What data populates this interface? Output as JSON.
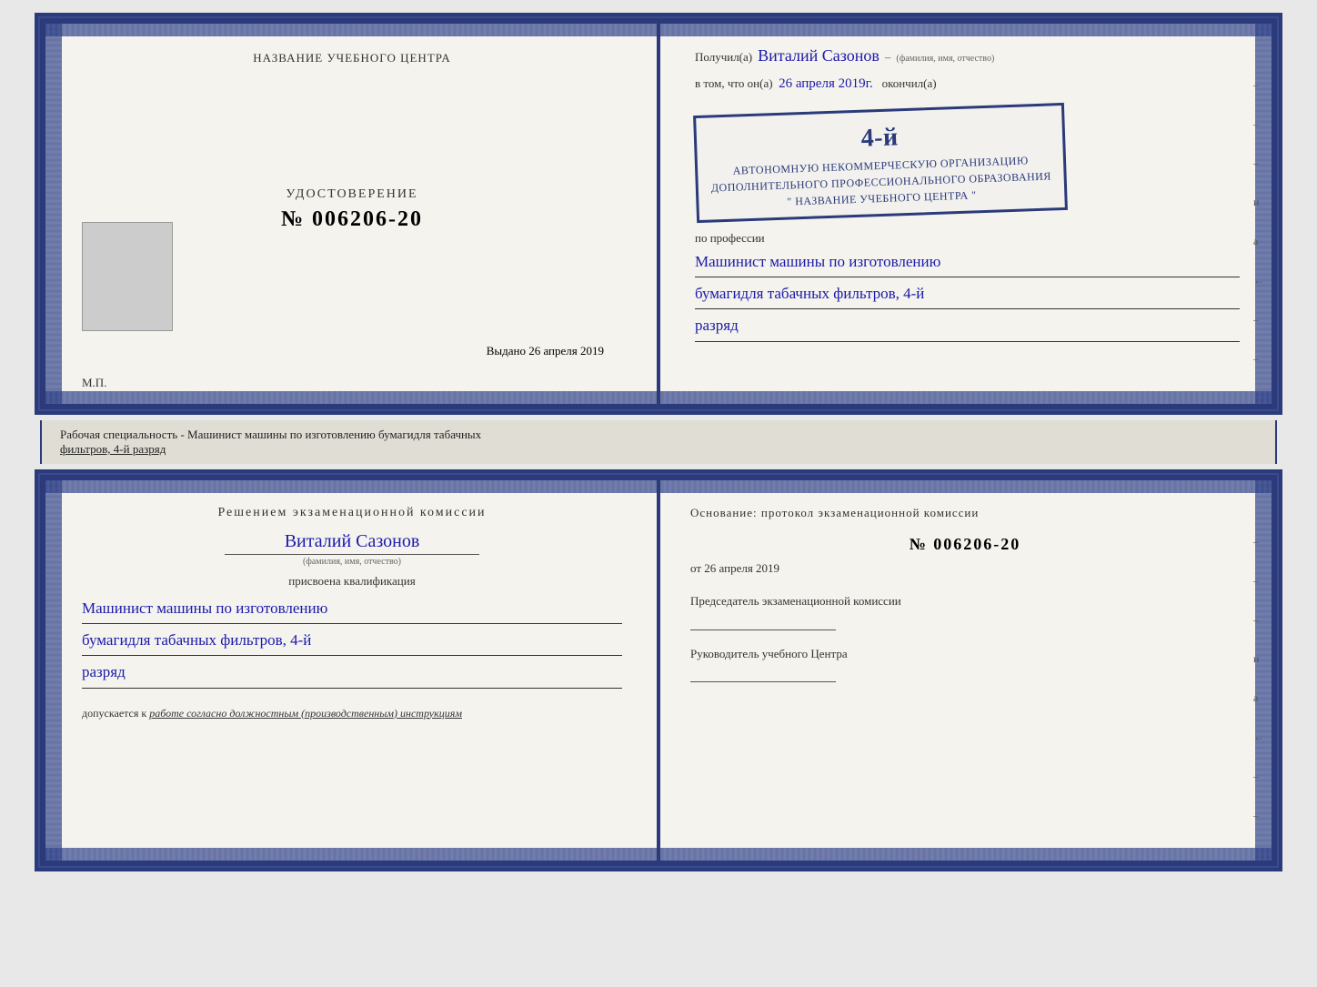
{
  "top": {
    "left": {
      "heading": "НАЗВАНИЕ УЧЕБНОГО ЦЕНТРА",
      "cert_label": "УДОСТОВЕРЕНИЕ",
      "cert_number": "№ 006206-20",
      "issued_label": "Выдано",
      "issued_date": "26 апреля 2019",
      "mp_label": "М.П."
    },
    "right": {
      "received_label": "Получил(а)",
      "recipient_name": "Виталий Сазонов",
      "recipient_subtext": "(фамилия, имя, отчество)",
      "in_fact_label": "в том, что он(а)",
      "date_filled": "26 апреля 2019г.",
      "completed_label": "окончил(а)",
      "stamp_line1": "4-й",
      "stamp_line2": "АВТОНОМНУЮ НЕКОММЕРЧЕСКУЮ ОРГАНИЗАЦИЮ",
      "stamp_line3": "ДОПОЛНИТЕЛЬНОГО ПРОФЕССИОНАЛЬНОГО ОБРАЗОВАНИЯ",
      "stamp_line4": "\" НАЗВАНИЕ УЧЕБНОГО ЦЕНТРА \"",
      "profession_label": "по профессии",
      "profession_line1": "Машинист машины по изготовлению",
      "profession_line2": "бумагидля табачных фильтров, 4-й",
      "profession_line3": "разряд",
      "edge_marks": [
        "–",
        "–",
        "–",
        "и",
        "а",
        "←",
        "–",
        "–",
        "–",
        "–"
      ]
    }
  },
  "divider": {
    "text_normal": "Рабочая специальность - Машинист машины по изготовлению бумагидля табачных",
    "text_underline": "фильтров, 4-й разряд"
  },
  "bottom": {
    "left": {
      "commission_title": "Решением  экзаменационной  комиссии",
      "person_name": "Виталий Сазонов",
      "person_subtext": "(фамилия, имя, отчество)",
      "qualifier_text": "присвоена квалификация",
      "qualification_line1": "Машинист машины по изготовлению",
      "qualification_line2": "бумагидля табачных фильтров, 4-й",
      "qualification_line3": "разряд",
      "allow_label": "допускается к",
      "allow_text": "работе согласно должностным (производственным) инструкциям"
    },
    "right": {
      "basis_label": "Основание: протокол экзаменационной  комиссии",
      "number": "№  006206-20",
      "date_prefix": "от",
      "date": "26 апреля 2019",
      "chairman_label": "Председатель экзаменационной комиссии",
      "director_label": "Руководитель учебного Центра",
      "edge_marks": [
        "–",
        "–",
        "–",
        "и",
        "а",
        "←",
        "–",
        "–",
        "–",
        "–"
      ]
    }
  }
}
